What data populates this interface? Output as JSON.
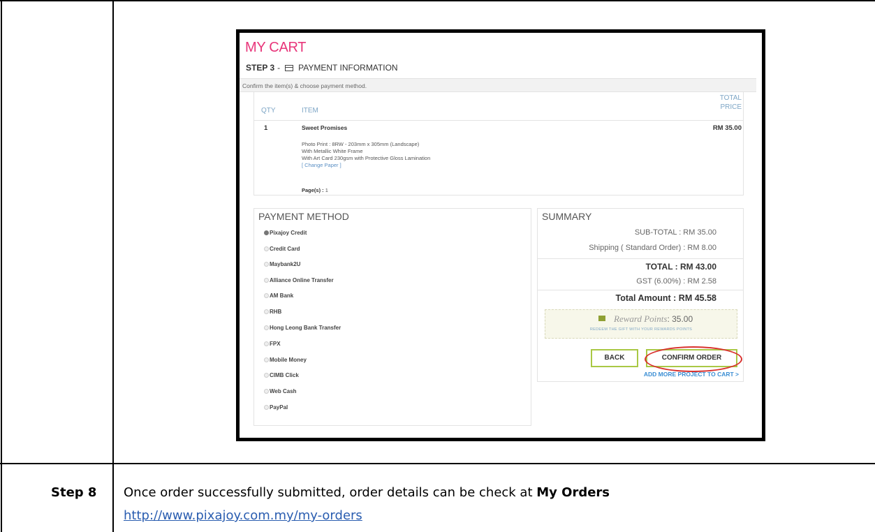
{
  "cart": {
    "title": "MY CART",
    "step_number": "STEP 3",
    "step_separator": "-",
    "step_title": "PAYMENT INFORMATION",
    "instruction": "Confirm the item(s) & choose payment method.",
    "columns": {
      "qty": "QTY",
      "item": "ITEM",
      "total_line1": "TOTAL",
      "total_line2": "PRICE"
    },
    "item": {
      "qty": "1",
      "name": "Sweet Promises",
      "price": "RM 35.00",
      "details": [
        "Photo Print : 8RW - 203mm x 305mm (Landscape)",
        "With Metallic White Frame",
        "With Art Card 230gsm with Protective Gloss Lamination"
      ],
      "change_paper": "[ Change Paper ]",
      "pages_label": "Page(s) :",
      "pages_value": "1"
    },
    "payment": {
      "title": "PAYMENT METHOD",
      "selected": "Pixajoy Credit",
      "options": [
        "Pixajoy Credit",
        "Credit Card",
        "Maybank2U",
        "Alliance Online Transfer",
        "AM Bank",
        "RHB",
        "Hong Leong Bank Transfer",
        "FPX",
        "Mobile Money",
        "CIMB Click",
        "Web Cash",
        "PayPal"
      ]
    },
    "summary": {
      "title": "SUMMARY",
      "subtotal": "SUB-TOTAL :  RM  35.00",
      "shipping": "Shipping ( Standard Order) :  RM  8.00",
      "total": "TOTAL :  RM  43.00",
      "gst": "GST (6.00%) :  RM  2.58",
      "total_amount": "Total Amount :  RM 45.58",
      "reward_label": "Reward Points",
      "reward_value": ": 35.00",
      "reward_sub": "REDEEM THE GIFT WITH YOUR REWARDS POINTS",
      "back": "BACK",
      "confirm": "CONFIRM ORDER",
      "add_more": "ADD MORE PROJECT TO CART >"
    },
    "colors": {
      "brand": "#e8357a",
      "button_border": "#a9c845",
      "highlight": "#d9312e",
      "link": "#3b8ed4"
    }
  },
  "step8": {
    "label": "Step 8",
    "text_prefix": "Once order successfully submitted, order details can be check at ",
    "text_bold": "My Orders",
    "link": "http://www.pixajoy.com.my/my-orders"
  }
}
